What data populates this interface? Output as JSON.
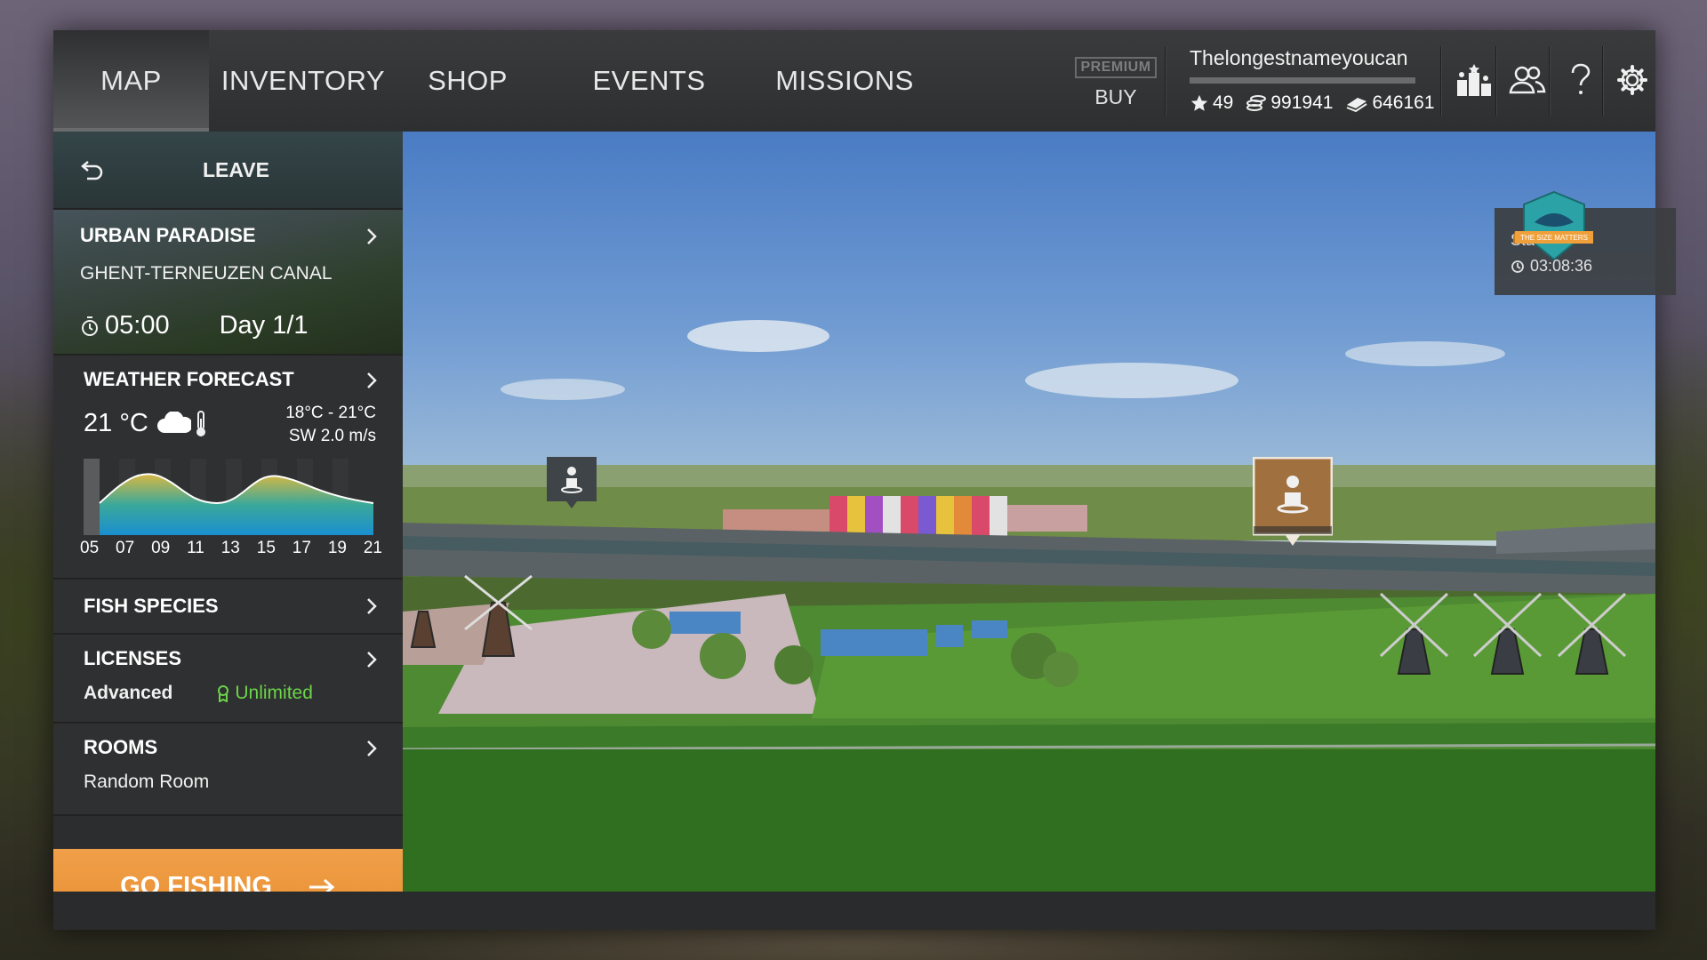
{
  "nav": {
    "tabs": [
      {
        "label": "MAP",
        "active": true
      },
      {
        "label": "INVENTORY"
      },
      {
        "label": "SHOP"
      },
      {
        "label": "EVENTS"
      },
      {
        "label": "MISSIONS"
      }
    ],
    "premium_label": "PREMIUM",
    "buy_label": "BUY"
  },
  "player": {
    "name": "Thelongestnameyoucan",
    "stars": "49",
    "coins": "991941",
    "cash": "646161"
  },
  "panel": {
    "leave_label": "LEAVE",
    "location": {
      "title": "URBAN PARADISE",
      "subtitle": "GHENT-TERNEUZEN CANAL",
      "time": "05:00",
      "day": "Day 1/1"
    },
    "weather": {
      "title": "WEATHER FORECAST",
      "temp": "21 °C",
      "range": "18°C - 21°C",
      "wind": "SW 2.0 m/s",
      "hours": [
        "05",
        "07",
        "09",
        "11",
        "13",
        "15",
        "17",
        "19",
        "21"
      ]
    },
    "fish_species": "FISH SPECIES",
    "licenses": {
      "title": "LICENSES",
      "type": "Advanced",
      "duration": "Unlimited"
    },
    "rooms": {
      "title": "ROOMS",
      "value": "Random Room"
    },
    "go_label": "GO FISHING"
  },
  "event": {
    "starts_label": "Starts in:",
    "time": "03:08:36",
    "badge_text": "THE SIZE MATTERS"
  },
  "colors": {
    "accent_orange": "#e98f31",
    "license_green": "#6bd44a",
    "pin_brown": "#a0703f"
  }
}
